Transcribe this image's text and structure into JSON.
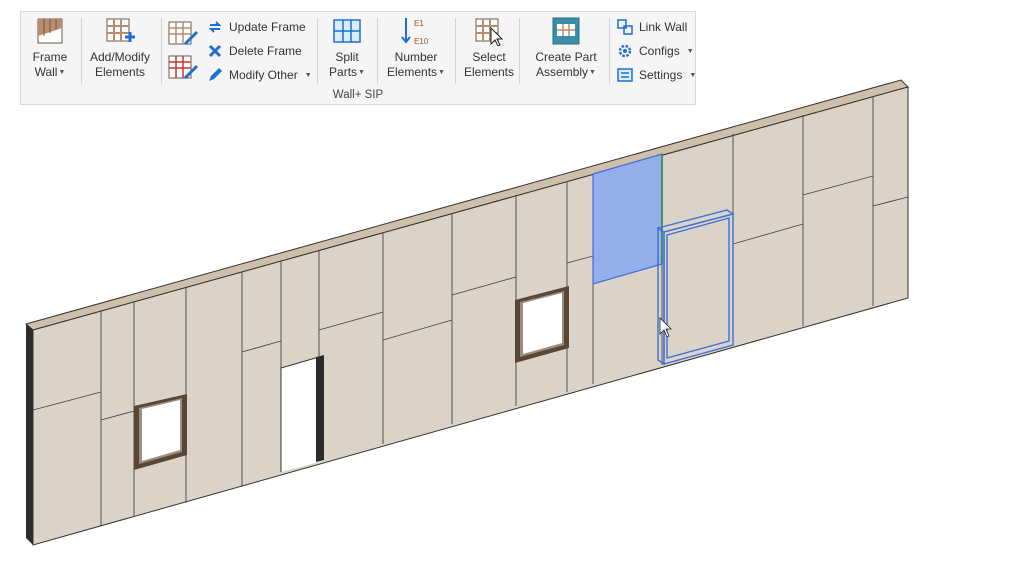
{
  "ribbon": {
    "group_label": "Wall+ SIP",
    "frame_wall": {
      "line1": "Frame",
      "line2": "Wall"
    },
    "add_modify": {
      "line1": "Add/Modify",
      "line2": "Elements"
    },
    "update_frame": "Update Frame",
    "delete_frame": "Delete Frame",
    "modify_other": "Modify Other",
    "split_parts": {
      "line1": "Split",
      "line2": "Parts"
    },
    "number_elements": {
      "line1": "Number",
      "line2": "Elements",
      "icon_top": "E1",
      "icon_bottom": "E10"
    },
    "select_elements": {
      "line1": "Select",
      "line2": "Elements"
    },
    "create_part_assembly": {
      "line1": "Create Part",
      "line2": "Assembly"
    },
    "link_wall": "Link Wall",
    "configs": "Configs",
    "settings": "Settings"
  },
  "colors": {
    "panel": "#dcd3c8",
    "wall_top": "#cdbfa9",
    "selection": "#93aee8",
    "highlight_outline": "#3b6fd8",
    "window_frame": "#5a4636"
  }
}
